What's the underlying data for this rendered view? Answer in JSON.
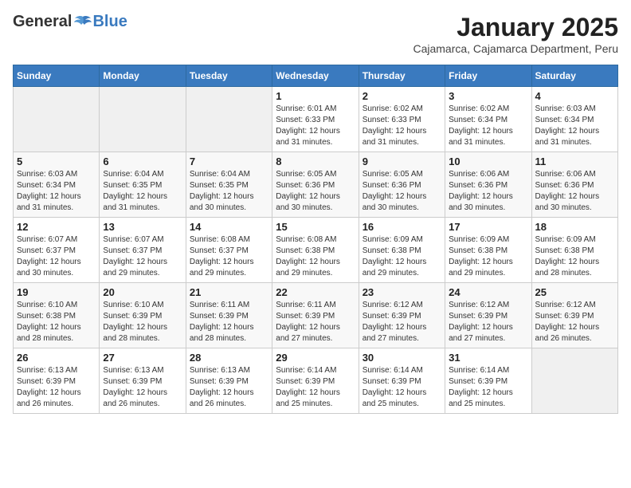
{
  "logo": {
    "general": "General",
    "blue": "Blue"
  },
  "title": "January 2025",
  "subtitle": "Cajamarca, Cajamarca Department, Peru",
  "days_of_week": [
    "Sunday",
    "Monday",
    "Tuesday",
    "Wednesday",
    "Thursday",
    "Friday",
    "Saturday"
  ],
  "weeks": [
    [
      {
        "day": "",
        "info": ""
      },
      {
        "day": "",
        "info": ""
      },
      {
        "day": "",
        "info": ""
      },
      {
        "day": "1",
        "info": "Sunrise: 6:01 AM\nSunset: 6:33 PM\nDaylight: 12 hours and 31 minutes."
      },
      {
        "day": "2",
        "info": "Sunrise: 6:02 AM\nSunset: 6:33 PM\nDaylight: 12 hours and 31 minutes."
      },
      {
        "day": "3",
        "info": "Sunrise: 6:02 AM\nSunset: 6:34 PM\nDaylight: 12 hours and 31 minutes."
      },
      {
        "day": "4",
        "info": "Sunrise: 6:03 AM\nSunset: 6:34 PM\nDaylight: 12 hours and 31 minutes."
      }
    ],
    [
      {
        "day": "5",
        "info": "Sunrise: 6:03 AM\nSunset: 6:34 PM\nDaylight: 12 hours and 31 minutes."
      },
      {
        "day": "6",
        "info": "Sunrise: 6:04 AM\nSunset: 6:35 PM\nDaylight: 12 hours and 31 minutes."
      },
      {
        "day": "7",
        "info": "Sunrise: 6:04 AM\nSunset: 6:35 PM\nDaylight: 12 hours and 30 minutes."
      },
      {
        "day": "8",
        "info": "Sunrise: 6:05 AM\nSunset: 6:36 PM\nDaylight: 12 hours and 30 minutes."
      },
      {
        "day": "9",
        "info": "Sunrise: 6:05 AM\nSunset: 6:36 PM\nDaylight: 12 hours and 30 minutes."
      },
      {
        "day": "10",
        "info": "Sunrise: 6:06 AM\nSunset: 6:36 PM\nDaylight: 12 hours and 30 minutes."
      },
      {
        "day": "11",
        "info": "Sunrise: 6:06 AM\nSunset: 6:36 PM\nDaylight: 12 hours and 30 minutes."
      }
    ],
    [
      {
        "day": "12",
        "info": "Sunrise: 6:07 AM\nSunset: 6:37 PM\nDaylight: 12 hours and 30 minutes."
      },
      {
        "day": "13",
        "info": "Sunrise: 6:07 AM\nSunset: 6:37 PM\nDaylight: 12 hours and 29 minutes."
      },
      {
        "day": "14",
        "info": "Sunrise: 6:08 AM\nSunset: 6:37 PM\nDaylight: 12 hours and 29 minutes."
      },
      {
        "day": "15",
        "info": "Sunrise: 6:08 AM\nSunset: 6:38 PM\nDaylight: 12 hours and 29 minutes."
      },
      {
        "day": "16",
        "info": "Sunrise: 6:09 AM\nSunset: 6:38 PM\nDaylight: 12 hours and 29 minutes."
      },
      {
        "day": "17",
        "info": "Sunrise: 6:09 AM\nSunset: 6:38 PM\nDaylight: 12 hours and 29 minutes."
      },
      {
        "day": "18",
        "info": "Sunrise: 6:09 AM\nSunset: 6:38 PM\nDaylight: 12 hours and 28 minutes."
      }
    ],
    [
      {
        "day": "19",
        "info": "Sunrise: 6:10 AM\nSunset: 6:38 PM\nDaylight: 12 hours and 28 minutes."
      },
      {
        "day": "20",
        "info": "Sunrise: 6:10 AM\nSunset: 6:39 PM\nDaylight: 12 hours and 28 minutes."
      },
      {
        "day": "21",
        "info": "Sunrise: 6:11 AM\nSunset: 6:39 PM\nDaylight: 12 hours and 28 minutes."
      },
      {
        "day": "22",
        "info": "Sunrise: 6:11 AM\nSunset: 6:39 PM\nDaylight: 12 hours and 27 minutes."
      },
      {
        "day": "23",
        "info": "Sunrise: 6:12 AM\nSunset: 6:39 PM\nDaylight: 12 hours and 27 minutes."
      },
      {
        "day": "24",
        "info": "Sunrise: 6:12 AM\nSunset: 6:39 PM\nDaylight: 12 hours and 27 minutes."
      },
      {
        "day": "25",
        "info": "Sunrise: 6:12 AM\nSunset: 6:39 PM\nDaylight: 12 hours and 26 minutes."
      }
    ],
    [
      {
        "day": "26",
        "info": "Sunrise: 6:13 AM\nSunset: 6:39 PM\nDaylight: 12 hours and 26 minutes."
      },
      {
        "day": "27",
        "info": "Sunrise: 6:13 AM\nSunset: 6:39 PM\nDaylight: 12 hours and 26 minutes."
      },
      {
        "day": "28",
        "info": "Sunrise: 6:13 AM\nSunset: 6:39 PM\nDaylight: 12 hours and 26 minutes."
      },
      {
        "day": "29",
        "info": "Sunrise: 6:14 AM\nSunset: 6:39 PM\nDaylight: 12 hours and 25 minutes."
      },
      {
        "day": "30",
        "info": "Sunrise: 6:14 AM\nSunset: 6:39 PM\nDaylight: 12 hours and 25 minutes."
      },
      {
        "day": "31",
        "info": "Sunrise: 6:14 AM\nSunset: 6:39 PM\nDaylight: 12 hours and 25 minutes."
      },
      {
        "day": "",
        "info": ""
      }
    ]
  ]
}
